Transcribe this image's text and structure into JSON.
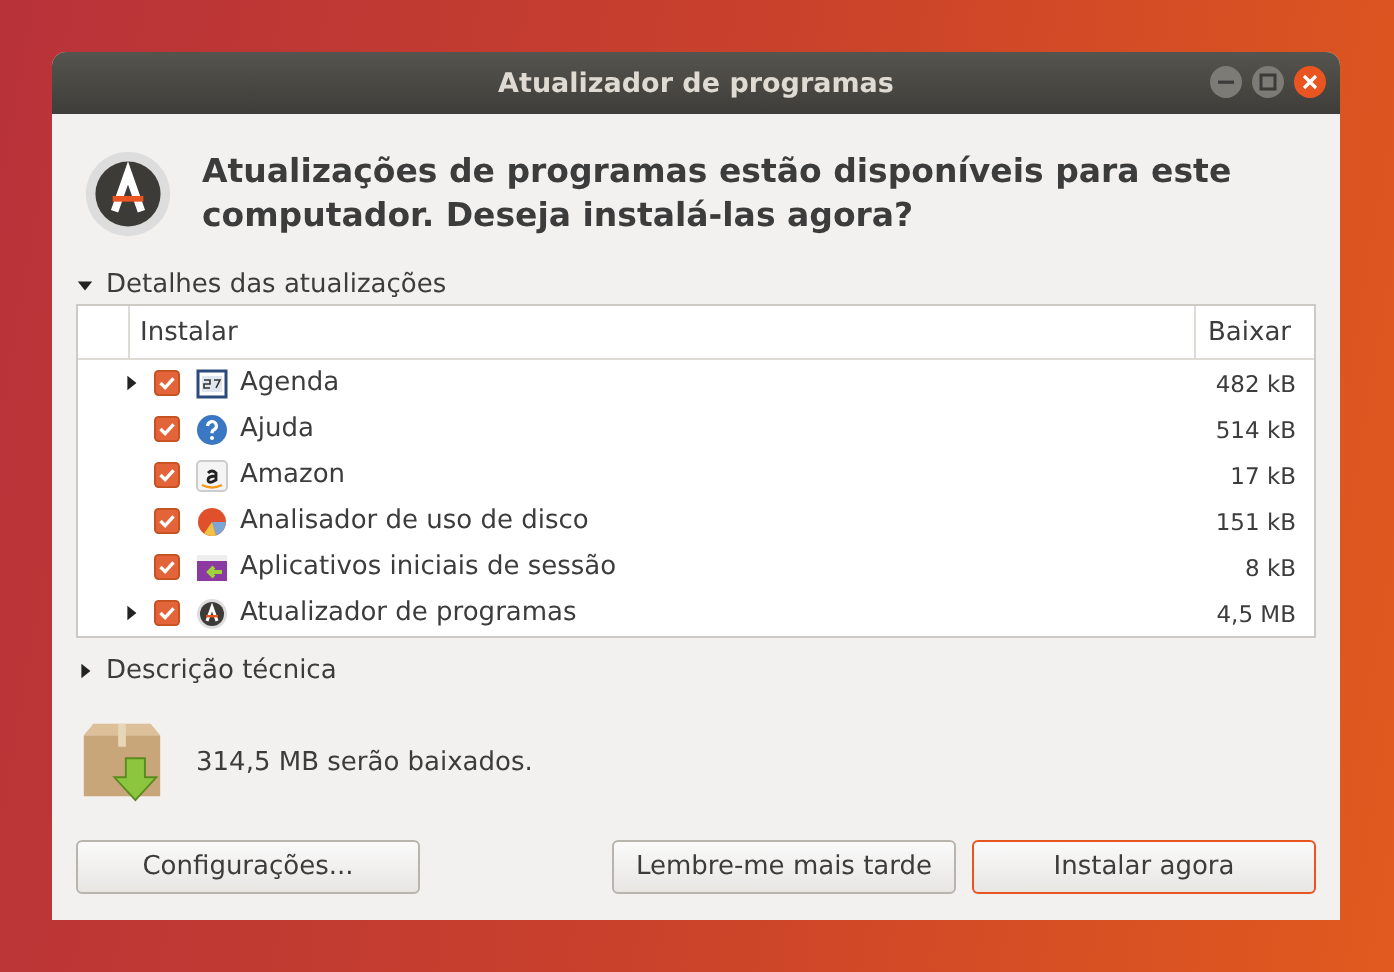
{
  "window": {
    "title": "Atualizador de programas"
  },
  "heading": "Atualizações de programas estão disponíveis para este computador. Deseja instalá-las agora?",
  "details": {
    "label": "Detalhes das atualizações",
    "expanded": true,
    "columns": [
      "Instalar",
      "Baixar"
    ],
    "rows": [
      {
        "name": "Agenda",
        "size": "482 kB",
        "checked": true,
        "has_children": true,
        "kind": "calendar"
      },
      {
        "name": "Ajuda",
        "size": "514 kB",
        "checked": true,
        "has_children": false,
        "kind": "help"
      },
      {
        "name": "Amazon",
        "size": "17 kB",
        "checked": true,
        "has_children": false,
        "kind": "amazon"
      },
      {
        "name": "Analisador de uso de disco",
        "size": "151 kB",
        "checked": true,
        "has_children": false,
        "kind": "disk"
      },
      {
        "name": "Aplicativos iniciais de sessão",
        "size": "8 kB",
        "checked": true,
        "has_children": false,
        "kind": "startup"
      },
      {
        "name": "Atualizador de programas",
        "size": "4,5 MB",
        "checked": true,
        "has_children": true,
        "kind": "updater"
      }
    ]
  },
  "technical": {
    "label": "Descrição técnica",
    "expanded": false
  },
  "download_summary": "314,5 MB serão baixados.",
  "buttons": [
    {
      "label": "Configurações...",
      "default": false
    },
    {
      "label": "Lembre-me mais tarde",
      "default": false
    },
    {
      "label": "Instalar agora",
      "default": true
    }
  ]
}
